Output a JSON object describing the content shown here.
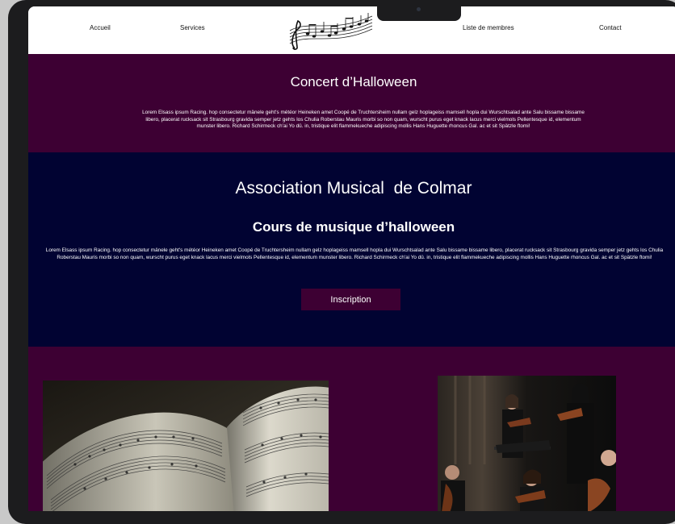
{
  "nav": {
    "items": [
      "Accueil",
      "Services",
      "Liste de membres",
      "Contact"
    ],
    "logo_icon": "music-staff-logo-icon"
  },
  "concert": {
    "title": "Concert d’Halloween",
    "text": "Lorem Elsass ipsum Racing. hop consectetur mänele geht's météor Heineken amet Coopé de Truchtersheim nullam gelz hoplageiss mamsell hopla dui Wurschtsalad ante Salu bissame bissame libero, placerat rucksack sit Strasbourg gravida semper jetz gehts los Chulia Roberstau Mauris morbi so non quam, wurscht purus eget knack lacus merci vielmols Pellentesque id, elementum munster libero. Richard Schirmeck ch'ai Yo dû. in, tristique elit flammekueche adipiscing mollis Hans Huguette rhoncus Gal. ac et sit Spätzle ftomi!"
  },
  "association": {
    "title": "Association Musical  de Colmar",
    "subtitle": "Cours de musique d’halloween",
    "text": "Lorem Elsass ipsum Racing. hop consectetur mänele geht's météor Heineken amet Coopé de Truchtersheim nullam gelz hoplageiss mamsell hopla dui Wurschtsalad ante Salu bissame bissame libero, placerat rucksack sit Strasbourg gravida semper jetz gehts los Chulia Roberstau Mauris morbi so non quam, wurscht purus eget knack lacus merci vielmols Pellentesque id, elementum munster libero. Richard Schirmeck ch'ai Yo dû. in, tristique elit flammekueche adipiscing mollis Hans Huguette rhoncus Gal. ac et sit Spätzle ftomi!",
    "button_label": "Inscription"
  },
  "colors": {
    "plum": "#3d0033",
    "navy": "#010332",
    "white": "#ffffff"
  }
}
